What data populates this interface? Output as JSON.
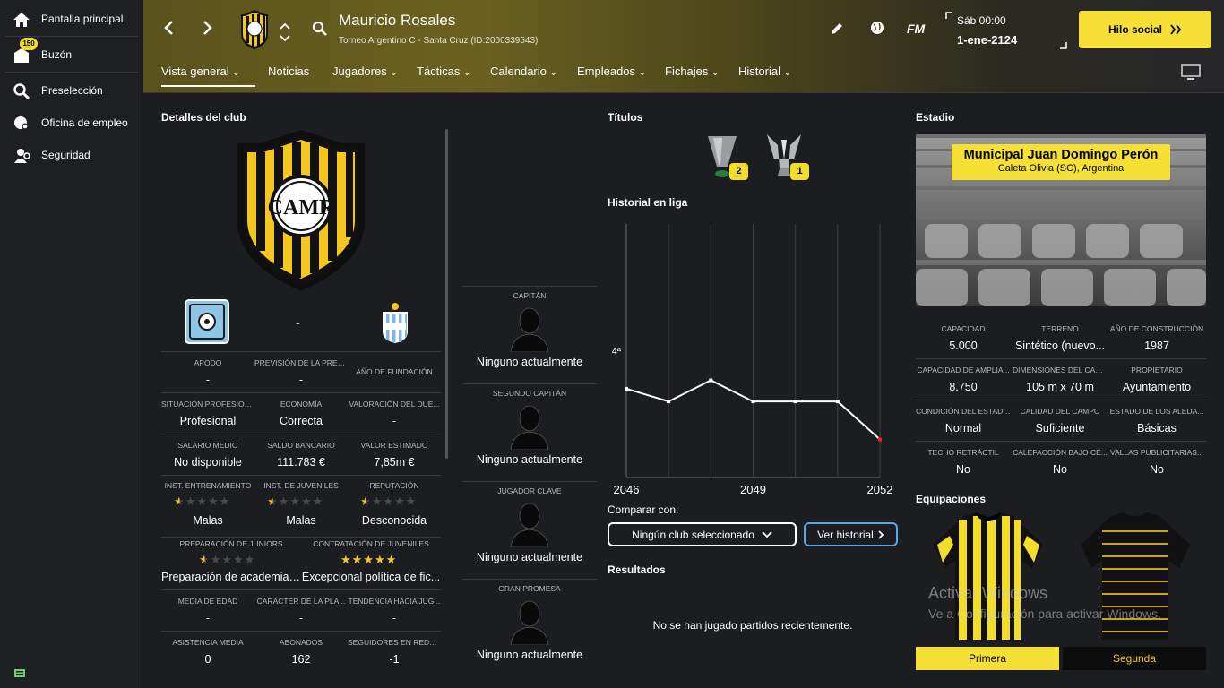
{
  "sidebar": {
    "items": [
      {
        "label": "Pantalla principal",
        "icon": "home-icon"
      },
      {
        "label": "Buzón",
        "icon": "inbox-icon",
        "badge": "150"
      },
      {
        "label": "Preselección",
        "icon": "search-icon"
      },
      {
        "label": "Oficina de empleo",
        "icon": "job-centre-icon"
      },
      {
        "label": "Seguridad",
        "icon": "security-icon"
      }
    ]
  },
  "header": {
    "manager_name": "Mauricio Rosales",
    "club_subtitle": "Torneo Argentino C - Santa Cruz (ID:2000339543)",
    "day_time": "Sáb 00:00",
    "date": "1-ene-2124",
    "fm_label": "FM",
    "social_button": "Hilo social",
    "tabs": [
      "Vista general",
      "Noticias",
      "Jugadores",
      "Tácticas",
      "Calendario",
      "Empleados",
      "Fichajes",
      "Historial"
    ]
  },
  "club": {
    "section_title": "Detalles del club",
    "crest_letters": "CAMR",
    "stats_row1": [
      {
        "label": "APODO",
        "value": "-"
      },
      {
        "label": "PREVISIÓN DE LA PREN...",
        "value": "-"
      },
      {
        "label": "AÑO DE FUNDACIÓN",
        "value": ""
      }
    ],
    "stats_row2": [
      {
        "label": "SITUACIÓN PROFESION...",
        "value": "Profesional"
      },
      {
        "label": "ECONOMÍA",
        "value": "Correcta"
      },
      {
        "label": "VALORACIÓN DEL DUE...",
        "value": "-"
      }
    ],
    "stats_row3": [
      {
        "label": "SALARIO MEDIO",
        "value": "No disponible"
      },
      {
        "label": "SALDO BANCARIO",
        "value": "111.783 €"
      },
      {
        "label": "VALOR ESTIMADO",
        "value": "7,85m €"
      }
    ],
    "stats_row4": [
      {
        "label": "INST. ENTRENAMIENTO",
        "value": "Malas",
        "stars": 0.5
      },
      {
        "label": "INST. DE JUVENILES",
        "value": "Malas",
        "stars": 0.5
      },
      {
        "label": "REPUTACIÓN",
        "value": "Desconocida",
        "stars": 0.5
      }
    ],
    "stats_row5": [
      {
        "label": "PREPARACIÓN DE JUNIORS",
        "value": "Preparación de academia b...",
        "stars": 0.5
      },
      {
        "label": "CONTRATACIÓN DE JUVENILES",
        "value": "Excepcional política de fic...",
        "stars": 5
      }
    ],
    "stats_row6": [
      {
        "label": "MEDIA DE EDAD",
        "value": "-"
      },
      {
        "label": "CARÁCTER DE LA PLA...",
        "value": "-"
      },
      {
        "label": "TENDENCIA HACIA JUG...",
        "value": "-"
      }
    ],
    "stats_row7": [
      {
        "label": "ASISTENCIA MEDIA",
        "value": "0"
      },
      {
        "label": "ABONADOS",
        "value": "162"
      },
      {
        "label": "SEGUIDORES EN REDES...",
        "value": "-1"
      }
    ],
    "level_separator": "-"
  },
  "roles": [
    {
      "label": "CAPITÁN",
      "value": "Ninguno actualmente"
    },
    {
      "label": "SEGUNDO CAPITÁN",
      "value": "Ninguno actualmente"
    },
    {
      "label": "JUGADOR CLAVE",
      "value": "Ninguno actualmente"
    },
    {
      "label": "GRAN PROMESA",
      "value": "Ninguno actualmente"
    }
  ],
  "titles": {
    "section_title": "Títulos",
    "trophies": [
      {
        "count": "2",
        "icon": "league-trophy-icon"
      },
      {
        "count": "1",
        "icon": "cup-trophy-icon"
      }
    ]
  },
  "league_history": {
    "section_title": "Historial en liga",
    "compare_label": "Comparar con:",
    "compare_select": "Ningún club seleccionado",
    "history_button": "Ver historial"
  },
  "chart_data": {
    "type": "line",
    "title": "Historial en liga",
    "x": [
      2046,
      2047,
      2048,
      2049,
      2050,
      2051,
      2052
    ],
    "x_tick_labels": [
      "2046",
      "2049",
      "2052"
    ],
    "y_tick_labels": [
      "4ª"
    ],
    "series": [
      {
        "values": [
          4.9,
          5.2,
          4.7,
          5.2,
          5.2,
          5.2,
          6.1
        ],
        "color": "#ffffff",
        "last_point_color": "#e0262a"
      }
    ],
    "ylim": [
      1,
      7
    ],
    "grid": true
  },
  "results": {
    "section_title": "Resultados",
    "empty_text": "No se han jugado partidos recientemente."
  },
  "stadium": {
    "section_title": "Estadio",
    "name": "Municipal Juan Domingo Perón",
    "location": "Caleta Olivia (SC), Argentina",
    "stats": [
      {
        "label": "CAPACIDAD",
        "value": "5.000"
      },
      {
        "label": "TERRENO",
        "value": "Sintético (nuevo..."
      },
      {
        "label": "AÑO DE CONSTRUCCIÓN",
        "value": "1987"
      },
      {
        "label": "CAPACIDAD DE AMPLIA...",
        "value": "8.750"
      },
      {
        "label": "DIMENSIONES DEL CAM...",
        "value": "105 m x 70 m"
      },
      {
        "label": "PROPIETARIO",
        "value": "Ayuntamiento"
      },
      {
        "label": "CONDICIÓN DEL ESTADIO",
        "value": "Normal"
      },
      {
        "label": "CALIDAD DEL CAMPO",
        "value": "Suficiente"
      },
      {
        "label": "ESTADO DE LOS ALEDA...",
        "value": "Básicas"
      },
      {
        "label": "TECHO RETRÁCTIL",
        "value": "No"
      },
      {
        "label": "CALEFACCIÓN BAJO CÉ...",
        "value": "No"
      },
      {
        "label": "VALLAS PUBLICITARIAS...",
        "value": "No"
      }
    ]
  },
  "kits": {
    "section_title": "Equipaciones",
    "home_label": "Primera",
    "away_label": "Segunda"
  },
  "watermark": {
    "line1": "Activar Windows",
    "line2": "Ve a Configuración para activar Windows."
  },
  "colors": {
    "accent_yellow": "#f6e036",
    "star_gold": "#f3c71f",
    "link_blue": "#5aa8e6"
  }
}
